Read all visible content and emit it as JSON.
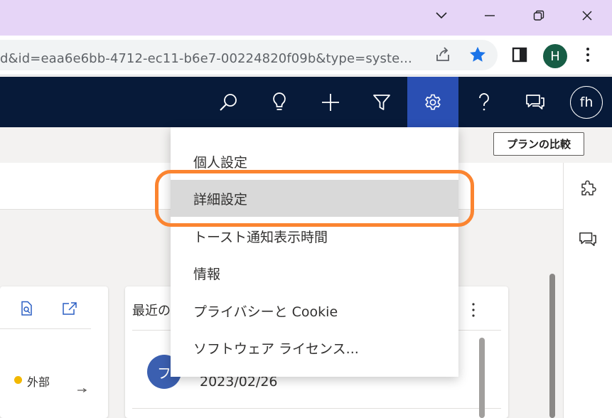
{
  "browser": {
    "url": "d&id=eaa6e6bb-4712-ec11-b6e7-00224820f09b&type=syste...",
    "profile_initial": "H"
  },
  "header": {
    "user_initials": "fh"
  },
  "commandbar": {
    "compare_plans": "プランの比較"
  },
  "settings_menu": {
    "items": [
      {
        "label": "個人設定"
      },
      {
        "label": "詳細設定"
      },
      {
        "label": "トースト通知表示時間"
      },
      {
        "label": "情報"
      },
      {
        "label": "プライバシーと Cookie"
      },
      {
        "label": "ソフトウェア ライセンス..."
      }
    ]
  },
  "cards": {
    "left_legend": "外部",
    "recent_title_partial": "最近の",
    "recent_avatar_initial": "フ",
    "recent_date": "2023/02/26"
  },
  "colors": {
    "titlebar": "#e6d5f7",
    "appbar": "#071a39",
    "active_icon_bg": "#2a4fb3",
    "highlight_ring": "#fb8430",
    "legend_dot": "#f2b800"
  }
}
